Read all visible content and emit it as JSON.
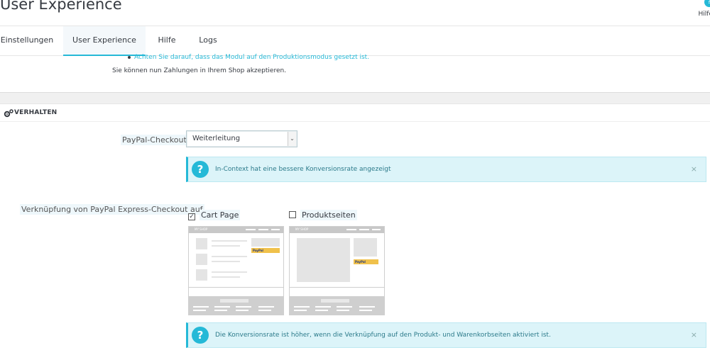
{
  "header": {
    "title": "User Experience",
    "help_label": "Hilfe"
  },
  "tabs": [
    {
      "label": "Einstellungen"
    },
    {
      "label": "User Experience"
    },
    {
      "label": "Hilfe"
    },
    {
      "label": "Logs"
    }
  ],
  "info": {
    "bullet": "Achten Sie darauf, dass das Modul auf den Produktionsmodus gesetzt ist.",
    "line": "Sie können nun Zahlungen in Ihrem Shop akzeptieren."
  },
  "section": {
    "title": "VERHALTEN"
  },
  "checkout": {
    "label": "PayPal-Checkout",
    "selected": "Weiterleitung",
    "alert": "In-Context hat eine bessere Konversionsrate angezeigt"
  },
  "express": {
    "label": "Verknüpfung von PayPal Express-Checkout auf",
    "options": [
      {
        "label": "Cart Page",
        "checked": true
      },
      {
        "label": "Produktseiten",
        "checked": false
      }
    ],
    "mock_shop_text": "MY SHOP",
    "paypal_text": "PayPal",
    "alert": "Die Konversionsrate ist höher, wenn die Verknüpfung auf den Produkt- und Warenkorbseiten aktiviert ist."
  },
  "icons": {
    "help": "question-circle-icon",
    "gear": "gears-icon",
    "close": "close-icon",
    "caret": "caret-down-icon",
    "checkbox_checked": "checkbox-checked-icon",
    "checkbox_unchecked": "checkbox-unchecked-icon"
  },
  "colors": {
    "accent": "#25b9d7",
    "alert_bg": "#dcf4f9",
    "text": "#363a41"
  }
}
